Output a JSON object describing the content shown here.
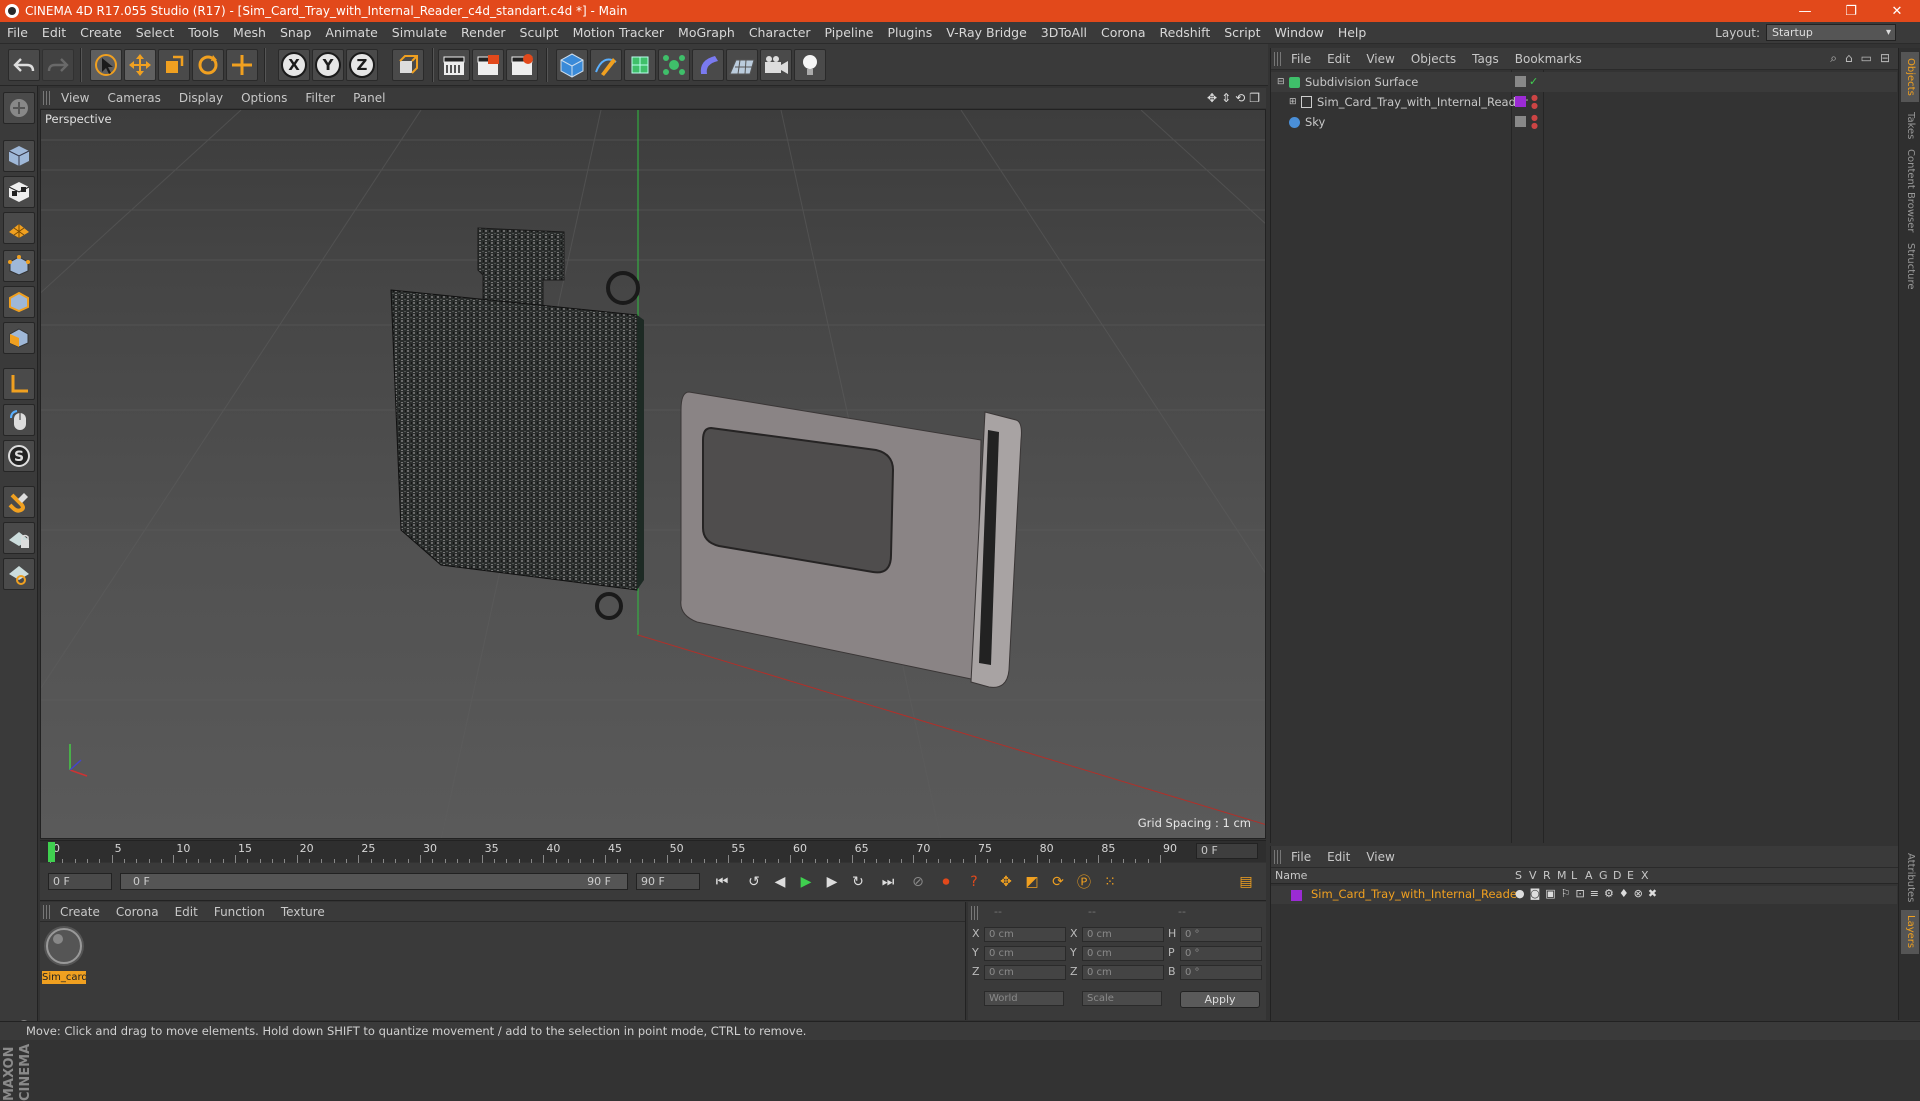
{
  "window": {
    "title": "CINEMA 4D R17.055 Studio (R17) - [Sim_Card_Tray_with_Internal_Reader_c4d_standart.c4d *] - Main",
    "minimize": "—",
    "restore": "❐",
    "close": "✕"
  },
  "menu": [
    "File",
    "Edit",
    "Create",
    "Select",
    "Tools",
    "Mesh",
    "Snap",
    "Animate",
    "Simulate",
    "Render",
    "Sculpt",
    "Motion Tracker",
    "MoGraph",
    "Character",
    "Pipeline",
    "Plugins",
    "V-Ray Bridge",
    "3DToAll",
    "Corona",
    "Redshift",
    "Script",
    "Window",
    "Help"
  ],
  "layout": {
    "label": "Layout:",
    "value": "Startup"
  },
  "axes": {
    "x": "X",
    "y": "Y",
    "z": "Z"
  },
  "viewport": {
    "menu": [
      "View",
      "Cameras",
      "Display",
      "Options",
      "Filter",
      "Panel"
    ],
    "label": "Perspective",
    "grid_spacing": "Grid Spacing : 1 cm"
  },
  "timeline": {
    "ticks": [
      "0",
      "5",
      "10",
      "15",
      "20",
      "25",
      "30",
      "35",
      "40",
      "45",
      "50",
      "55",
      "60",
      "65",
      "70",
      "75",
      "80",
      "85",
      "90"
    ],
    "current": "0 F"
  },
  "transport": {
    "start": "0 F",
    "range_start": "0 F",
    "range_end": "90 F",
    "end": "90 F"
  },
  "material": {
    "menu": [
      "Create",
      "Corona",
      "Edit",
      "Function",
      "Texture"
    ],
    "swatch_label": "Sim_card"
  },
  "coords": {
    "header": [
      "--",
      "--",
      "--"
    ],
    "rows": [
      {
        "a": "X",
        "av": "0 cm",
        "b": "X",
        "bv": "0 cm",
        "c": "H",
        "cv": "0 °"
      },
      {
        "a": "Y",
        "av": "0 cm",
        "b": "Y",
        "bv": "0 cm",
        "c": "P",
        "cv": "0 °"
      },
      {
        "a": "Z",
        "av": "0 cm",
        "b": "Z",
        "bv": "0 cm",
        "c": "B",
        "cv": "0 °"
      }
    ],
    "mode": "World",
    "type": "Scale",
    "apply": "Apply"
  },
  "objects": {
    "menu": [
      "File",
      "Edit",
      "View",
      "Objects",
      "Tags",
      "Bookmarks"
    ],
    "items": [
      {
        "name": "Subdivision Surface",
        "color": "#3fbf6a"
      },
      {
        "name": "Sim_Card_Tray_with_Internal_Reader",
        "color": "#9b2bd4"
      },
      {
        "name": "Sky",
        "color": "#4a8fd8"
      }
    ]
  },
  "layers": {
    "menu": [
      "File",
      "Edit",
      "View"
    ],
    "columns": {
      "name": "Name",
      "flags": [
        "S",
        "V",
        "R",
        "M",
        "L",
        "A",
        "G",
        "D",
        "E",
        "X"
      ]
    },
    "item": "Sim_Card_Tray_with_Internal_Reader"
  },
  "sidetabs": [
    "Objects",
    "Takes",
    "Content Browser",
    "Structure",
    "Attributes",
    "Layers"
  ],
  "brand": "MAXON CINEMA 4D",
  "status": "Move: Click and drag to move elements. Hold down SHIFT to quantize movement / add to the selection in point mode, CTRL to remove."
}
